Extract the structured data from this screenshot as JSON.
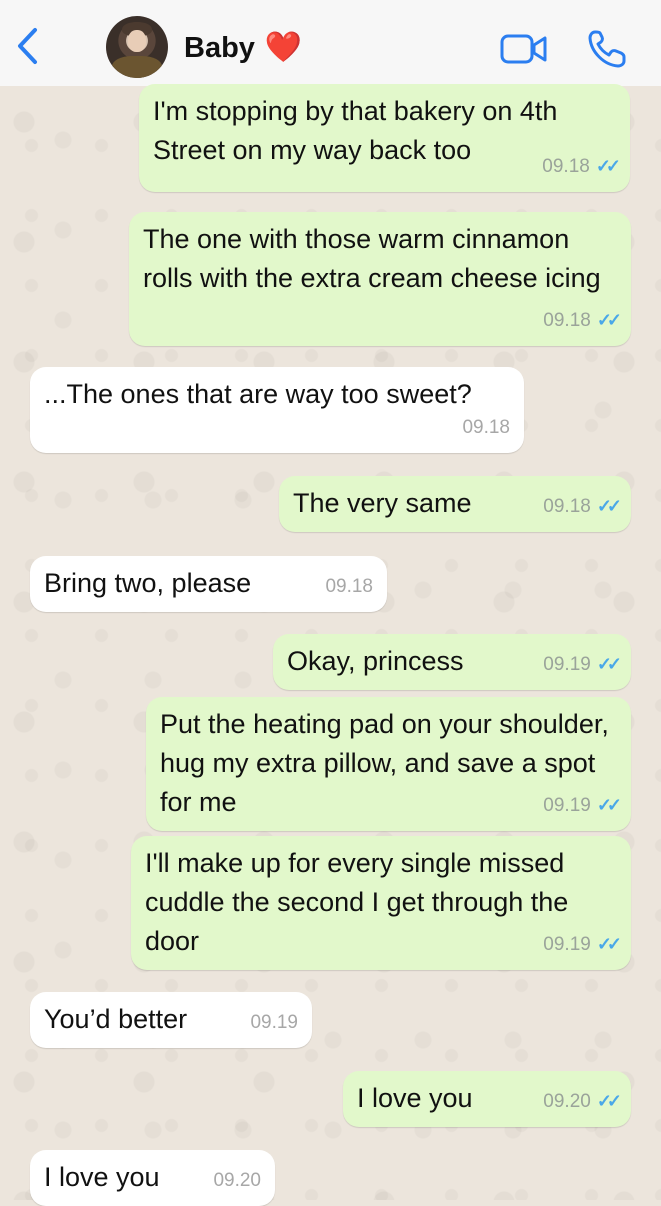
{
  "header": {
    "back_icon": "chevron-left-icon",
    "contact_name": "Baby",
    "heart": "❤️",
    "video_icon": "video-call-icon",
    "call_icon": "phone-icon",
    "accent": "#2b7ef0"
  },
  "messages": [
    {
      "dir": "out",
      "text": "I'm stopping by that bakery on 4th Street on my way back too",
      "time": "09.18",
      "read": true
    },
    {
      "dir": "out",
      "text": "The one with those warm cinnamon rolls with the extra cream cheese icing",
      "time": "09.18",
      "read": true
    },
    {
      "dir": "in",
      "text": "...The ones that are way too sweet?",
      "time": "09.18"
    },
    {
      "dir": "out",
      "text": "The very same",
      "time": "09.18",
      "read": true
    },
    {
      "dir": "in",
      "text": "Bring two, please",
      "time": "09.18"
    },
    {
      "dir": "out",
      "text": "Okay, princess",
      "time": "09.19",
      "read": true
    },
    {
      "dir": "out",
      "text": "Put the heating pad on your shoulder, hug my extra pillow, and save a spot for me",
      "time": "09.19",
      "read": true
    },
    {
      "dir": "out",
      "text": "I'll make up for every single missed cuddle the second I get through the door",
      "time": "09.19",
      "read": true
    },
    {
      "dir": "in",
      "text": "You’d better",
      "time": "09.19"
    },
    {
      "dir": "out",
      "text": "I love you",
      "time": "09.20",
      "read": true
    },
    {
      "dir": "in",
      "text": "I love you",
      "time": "09.20"
    }
  ]
}
